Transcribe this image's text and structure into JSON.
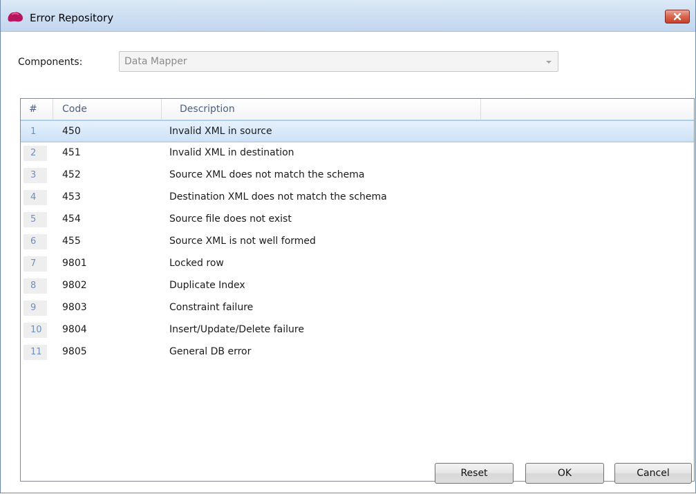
{
  "window": {
    "title": "Error Repository",
    "app_icon": "app-logo-icon",
    "close_icon": "close-icon",
    "close_color": "#c6402a"
  },
  "components": {
    "label": "Components:",
    "selected": "Data Mapper",
    "dropdown_icon": "chevron-down-icon"
  },
  "table": {
    "columns": [
      "#",
      "Code",
      "Description"
    ],
    "rows": [
      {
        "num": "1",
        "code": "450",
        "description": "Invalid XML in source",
        "selected": true
      },
      {
        "num": "2",
        "code": "451",
        "description": "Invalid XML in destination"
      },
      {
        "num": "3",
        "code": "452",
        "description": "Source XML does not match the schema"
      },
      {
        "num": "4",
        "code": "453",
        "description": "Destination XML does not match the schema"
      },
      {
        "num": "5",
        "code": "454",
        "description": "Source file does not exist"
      },
      {
        "num": "6",
        "code": "455",
        "description": "Source XML is not well formed"
      },
      {
        "num": "7",
        "code": "9801",
        "description": "Locked row"
      },
      {
        "num": "8",
        "code": "9802",
        "description": "Duplicate Index"
      },
      {
        "num": "9",
        "code": "9803",
        "description": "Constraint failure"
      },
      {
        "num": "10",
        "code": "9804",
        "description": "Insert/Update/Delete failure"
      },
      {
        "num": "11",
        "code": "9805",
        "description": "General DB error"
      }
    ]
  },
  "buttons": {
    "reset": "Reset",
    "ok": "OK",
    "cancel": "Cancel"
  },
  "colors": {
    "selection": "#cce2f8",
    "header_text": "#4d6082",
    "row_number_text": "#6f8fbf"
  }
}
